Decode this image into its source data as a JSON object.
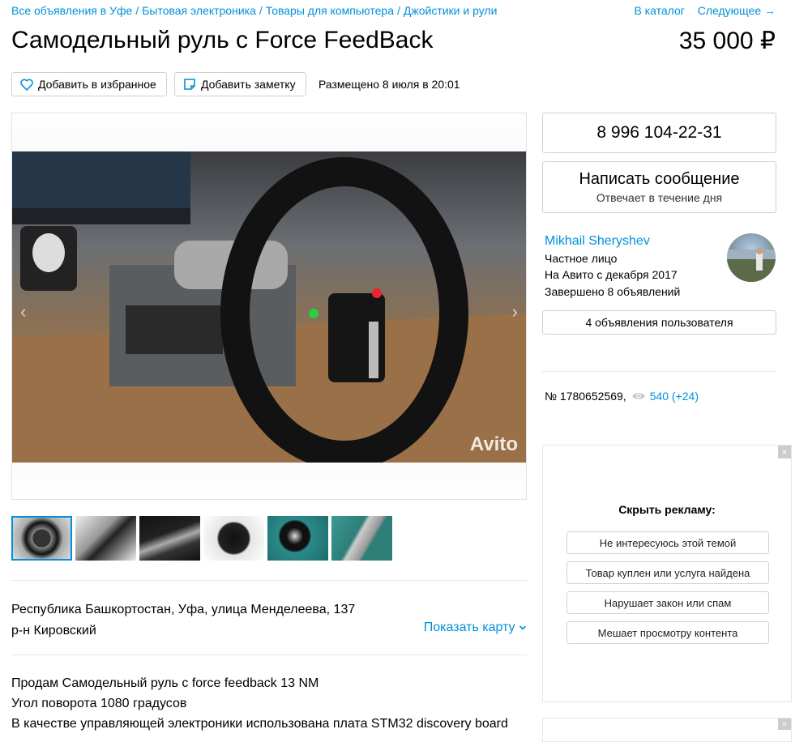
{
  "breadcrumbs": [
    "Все объявления в Уфе",
    "Бытовая электроника",
    "Товары для компьютера",
    "Джойстики и рули"
  ],
  "nav": {
    "catalog": "В каталог",
    "next": "Следующее →"
  },
  "listing": {
    "title": "Самодельный руль с Force FeedBack",
    "price": "35 000 ₽",
    "favorite_label": "Добавить в избранное",
    "note_label": "Добавить заметку",
    "posted": "Размещено 8 июля в 20:01"
  },
  "gallery": {
    "watermark": "Avito",
    "prev_icon": "chevron-left-icon",
    "next_icon": "chevron-right-icon",
    "thumbnails": [
      "steering-wheel",
      "mechanism",
      "pedals",
      "circuit-board",
      "encoder",
      "motor"
    ],
    "active_index": 0
  },
  "location": {
    "address": "Республика Башкортостан, Уфа, улица Менделеева, 137",
    "district": "р-н Кировский",
    "show_map": "Показать карту"
  },
  "description": [
    "Продам Самодельный руль с force feedback 13 NM",
    "Угол поворота 1080 градусов",
    "В качестве управляющей электроники использована плата STM32 discovery board"
  ],
  "contact": {
    "phone": "8 996 104-22-31",
    "message": "Написать сообщение",
    "reply_time": "Отвечает в течение дня"
  },
  "seller": {
    "name": "Mikhail Sheryshev",
    "type": "Частное лицо",
    "since": "На Авито с декабря 2017",
    "completed": "Завершено 8 объявлений",
    "user_ads": "4 объявления пользователя"
  },
  "stats": {
    "ad_number": "№ 1780652569,",
    "views": "540 (+24)"
  },
  "ad_hide": {
    "title": "Скрыть рекламу:",
    "options": [
      "Не интересуюсь этой темой",
      "Товар куплен или услуга найдена",
      "Нарушает закон или спам",
      "Мешает просмотру контента"
    ],
    "close": "×"
  },
  "colors": {
    "link": "#0091d9",
    "border": "#d1d1d1"
  }
}
